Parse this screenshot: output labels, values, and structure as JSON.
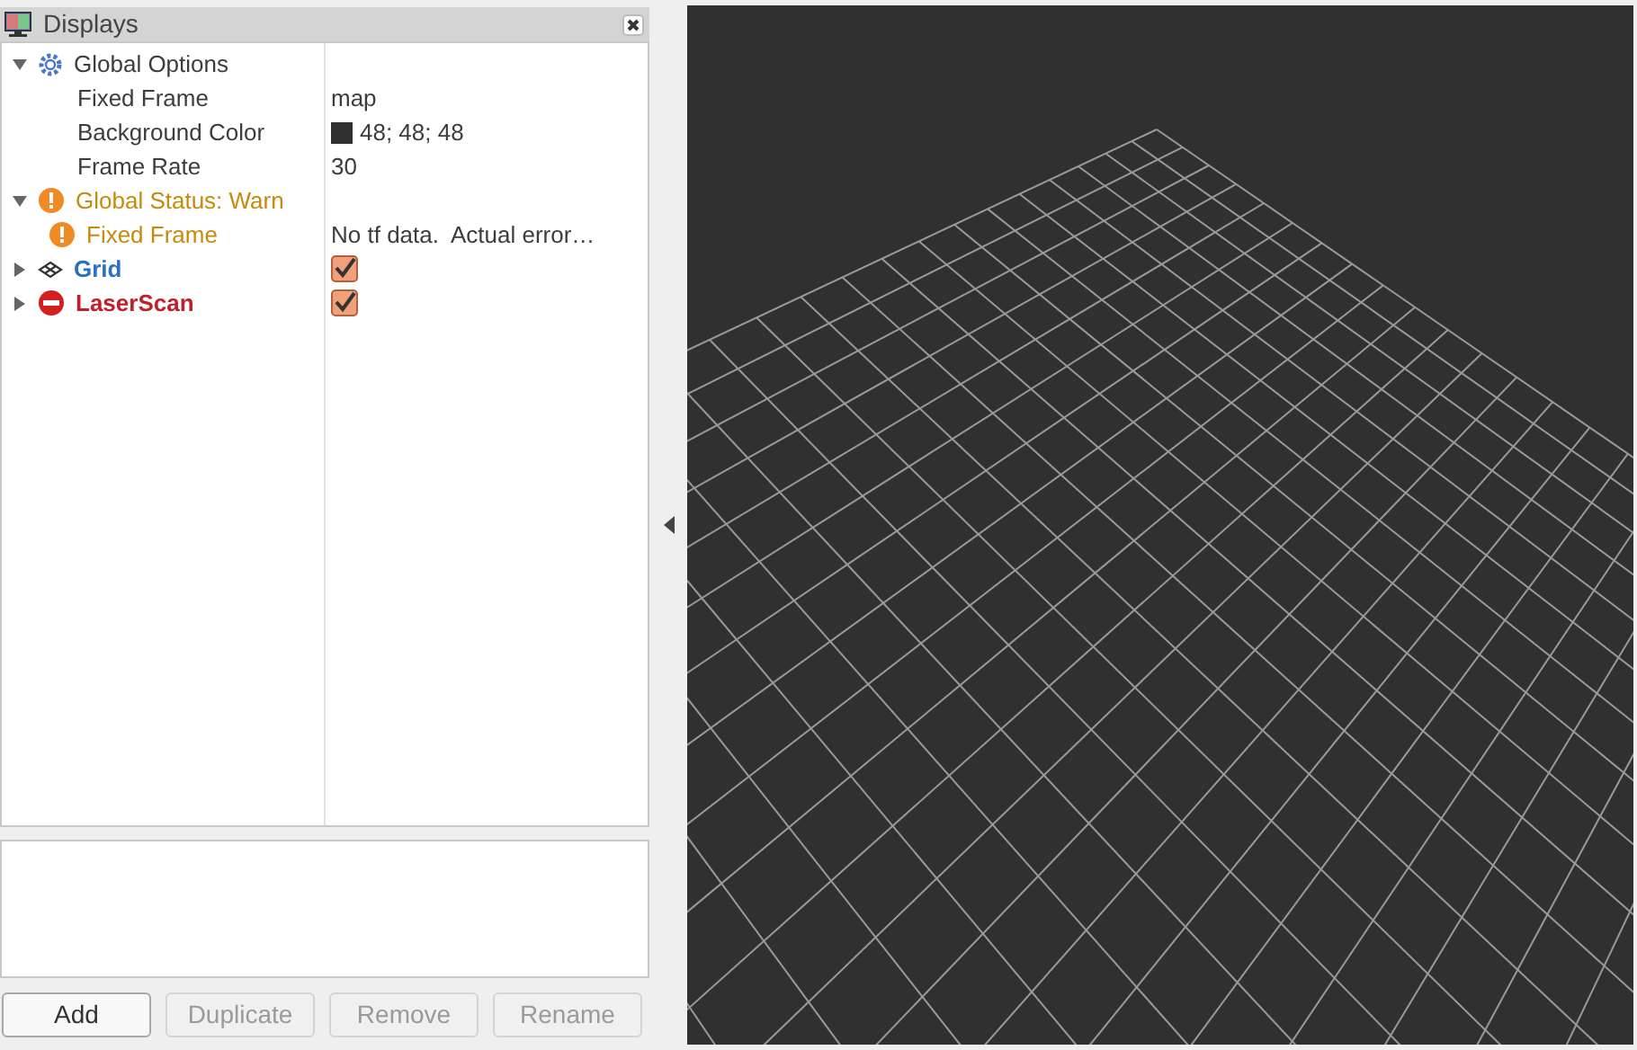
{
  "panel": {
    "title": "Displays"
  },
  "tree": [
    {
      "kind": "options",
      "label": "Global Options",
      "expanded": true,
      "children": [
        {
          "kind": "property",
          "label": "Fixed Frame",
          "value": "map"
        },
        {
          "kind": "color",
          "label": "Background Color",
          "value": "48; 48; 48",
          "color": "#303030"
        },
        {
          "kind": "property",
          "label": "Frame Rate",
          "value": "30"
        }
      ]
    },
    {
      "kind": "warn",
      "label": "Global Status: Warn",
      "expanded": true,
      "children": [
        {
          "kind": "warn",
          "label": "Fixed Frame",
          "value": "No tf data.  Actual error…"
        }
      ]
    },
    {
      "kind": "grid",
      "label": "Grid",
      "expanded": false,
      "checked": true
    },
    {
      "kind": "error",
      "label": "LaserScan",
      "expanded": false,
      "checked": true
    }
  ],
  "buttons": [
    {
      "label": "Add",
      "disabled": false
    },
    {
      "label": "Duplicate",
      "disabled": true
    },
    {
      "label": "Remove",
      "disabled": true
    },
    {
      "label": "Rename",
      "disabled": true
    }
  ]
}
